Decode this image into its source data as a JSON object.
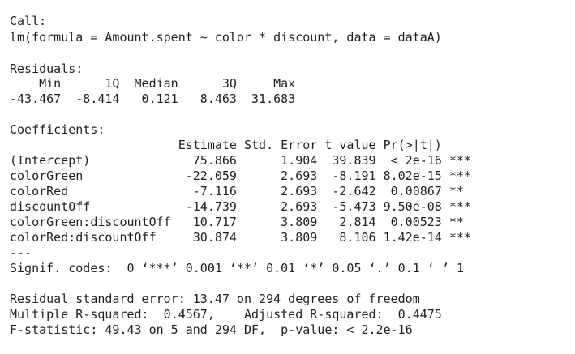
{
  "console": {
    "call_header": "Call:",
    "call_formula": "lm(formula = Amount.spent ~ color * discount, data = dataA)",
    "residuals_header": "Residuals:",
    "residuals_labels": "    Min      1Q  Median      3Q     Max ",
    "residuals_values": "-43.467  -8.414   0.121   8.463  31.683 ",
    "coefficients_header": "Coefficients:",
    "coef_columns": "                       Estimate Std. Error t value Pr(>|t|)    ",
    "coef_rows": [
      "(Intercept)              75.866      1.904  39.839  < 2e-16 ***",
      "colorGreen              -22.059      2.693  -8.191 8.02e-15 ***",
      "colorRed                 -7.116      2.693  -2.642  0.00867 ** ",
      "discountOff             -14.739      2.693  -5.473 9.50e-08 ***",
      "colorGreen:discountOff   10.717      3.809   2.814  0.00523 ** ",
      "colorRed:discountOff     30.874      3.809   8.106 1.42e-14 ***"
    ],
    "separator": "---",
    "signif_codes": "Signif. codes:  0 ‘***’ 0.001 ‘**’ 0.01 ‘*’ 0.05 ‘.’ 0.1 ‘ ’ 1",
    "residual_se": "Residual standard error: 13.47 on 294 degrees of freedom",
    "r_squared": "Multiple R-squared:  0.4567,\tAdjusted R-squared:  0.4475 ",
    "f_statistic": "F-statistic: 49.43 on 5 and 294 DF,  p-value: < 2.2e-16"
  }
}
